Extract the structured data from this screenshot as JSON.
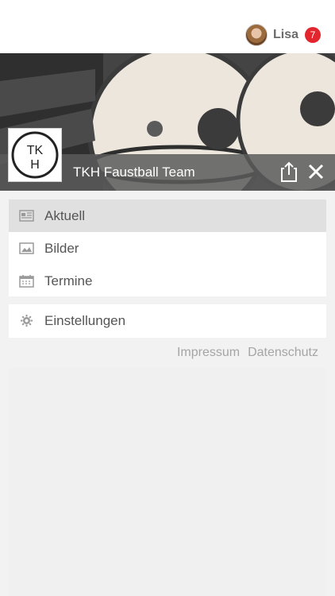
{
  "header": {
    "user_name": "Lisa",
    "notification_count": "7"
  },
  "hero": {
    "team_name": "TKH Faustball Team",
    "logo_text": "TKH"
  },
  "menu": {
    "items": [
      {
        "label": "Aktuell",
        "icon": "newspaper-icon",
        "active": true
      },
      {
        "label": "Bilder",
        "icon": "image-icon",
        "active": false
      },
      {
        "label": "Termine",
        "icon": "calendar-icon",
        "active": false
      }
    ],
    "settings": {
      "label": "Einstellungen",
      "icon": "gear-icon"
    }
  },
  "footer": {
    "impressum": "Impressum",
    "datenschutz": "Datenschutz"
  }
}
